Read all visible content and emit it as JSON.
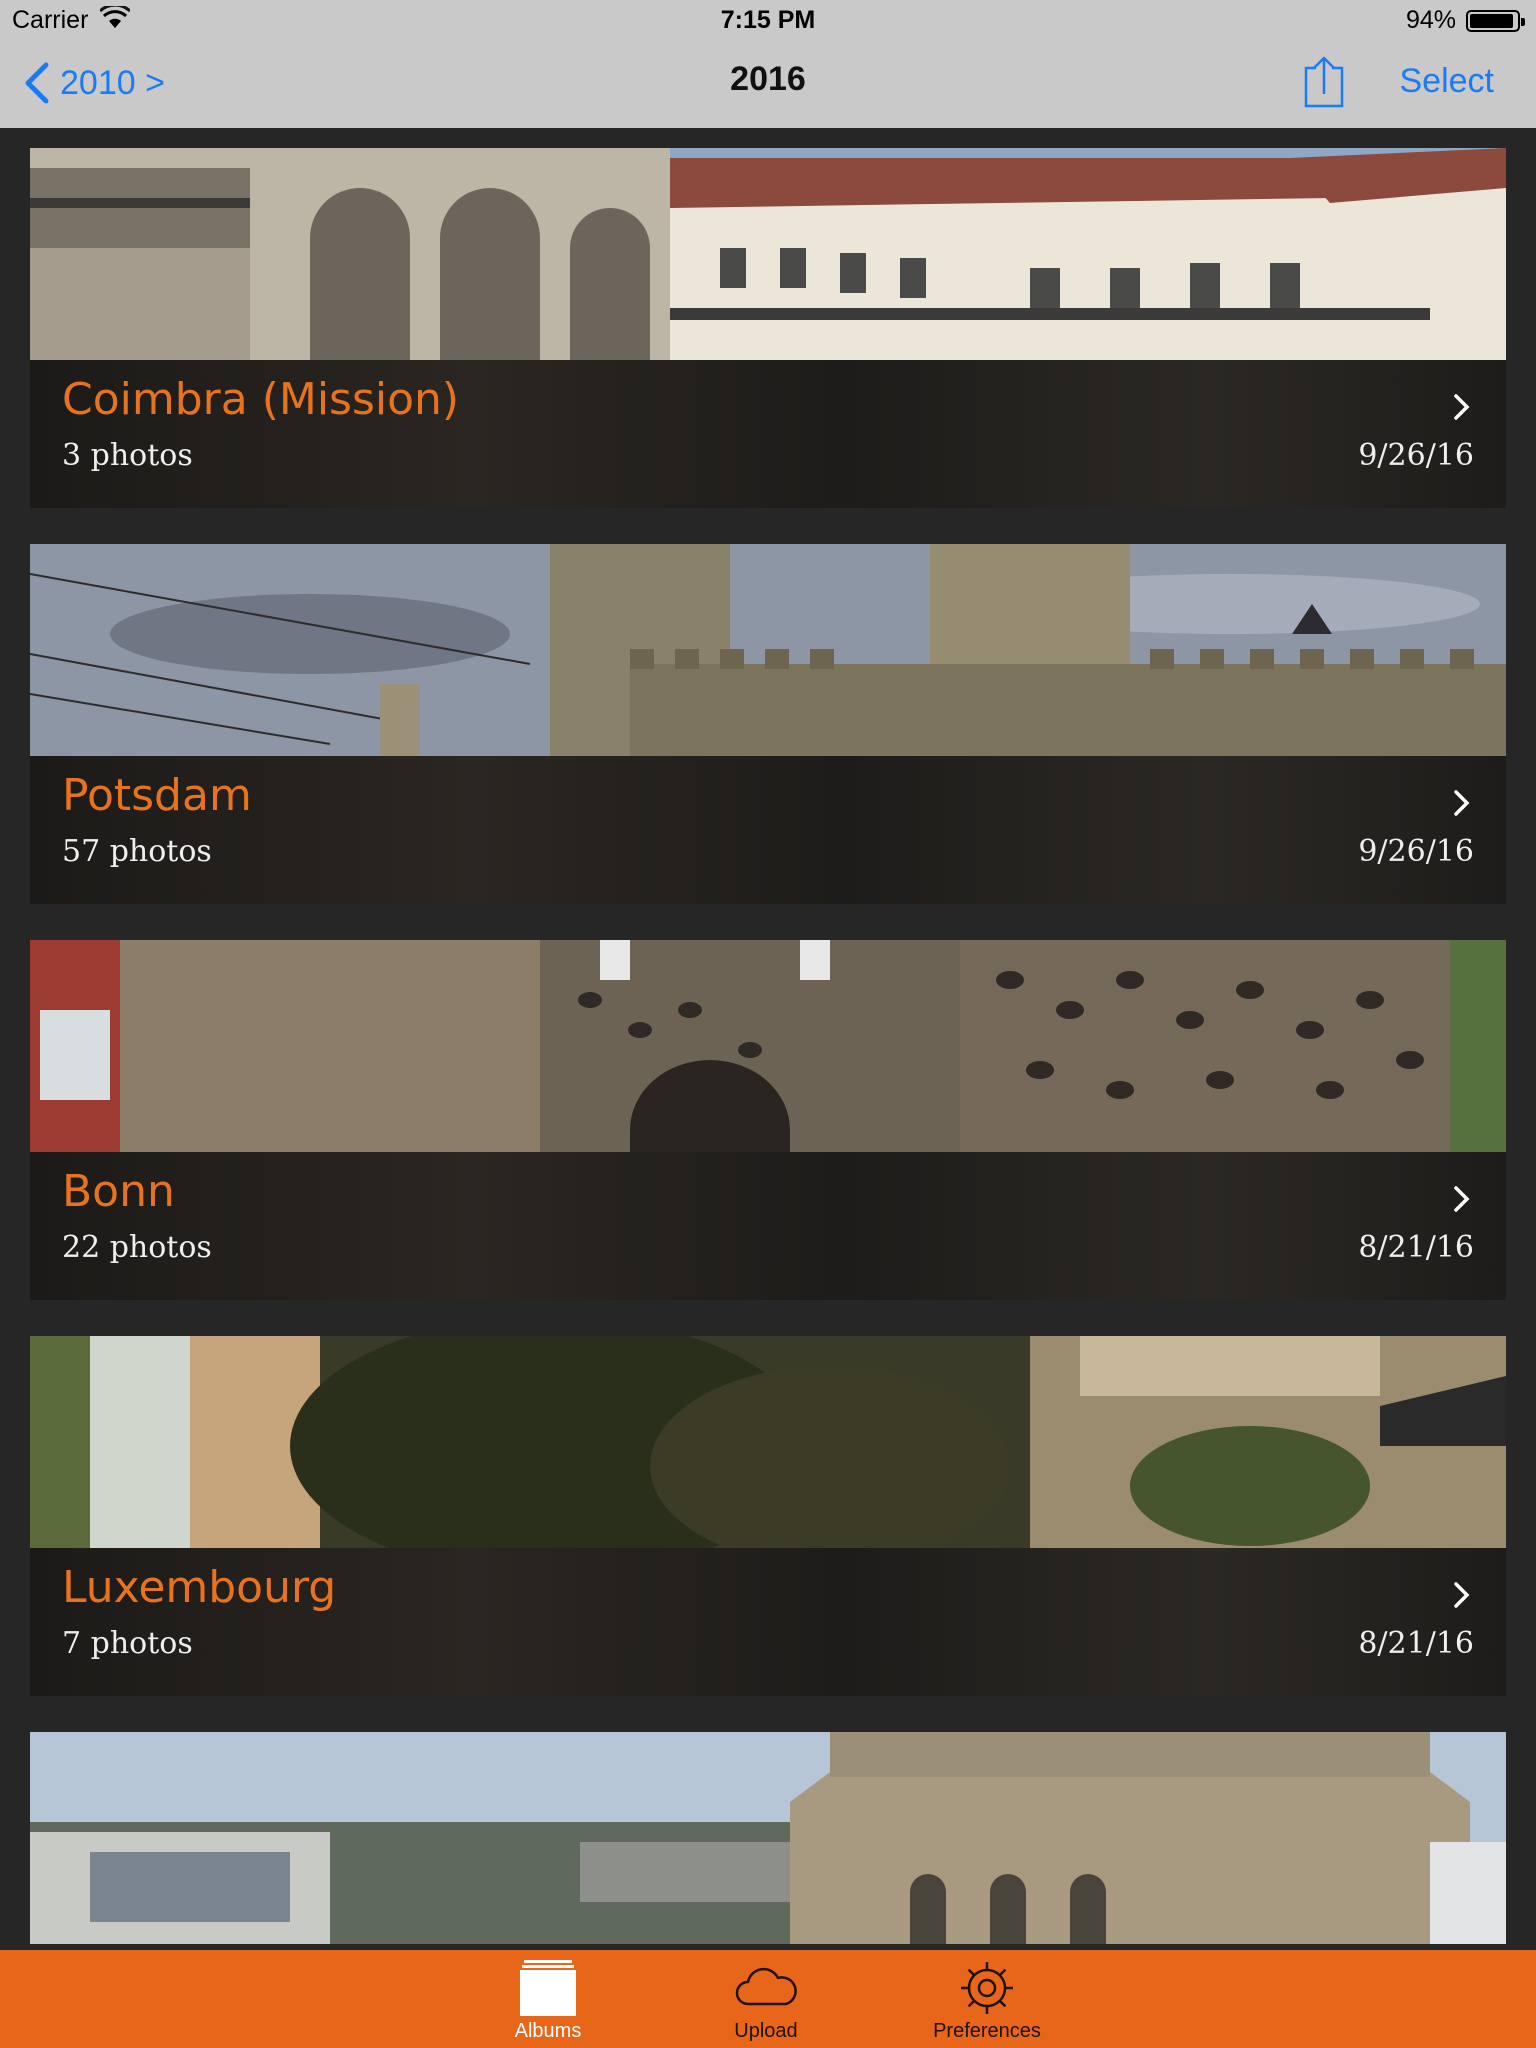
{
  "status_bar": {
    "carrier": "Carrier",
    "time": "7:15 PM",
    "battery_percent": "94%",
    "battery_level": 0.94
  },
  "nav_bar": {
    "back_label": "2010 >",
    "title": "2016",
    "share_icon": "share-icon",
    "select_label": "Select",
    "accent_color": "#1a7cf5"
  },
  "albums": [
    {
      "title": "Coimbra (Mission)",
      "count": "3 photos",
      "date": "9/26/16"
    },
    {
      "title": "Potsdam",
      "count": "57 photos",
      "date": "9/26/16"
    },
    {
      "title": "Bonn",
      "count": "22 photos",
      "date": "8/21/16"
    },
    {
      "title": "Luxembourg",
      "count": "7 photos",
      "date": "8/21/16"
    }
  ],
  "theme": {
    "album_title_color": "#e8731f",
    "tab_bar_color": "#e8661a",
    "background": "#262626"
  },
  "tab_bar": {
    "tabs": [
      {
        "label": "Albums",
        "icon": "albums-icon",
        "active": true
      },
      {
        "label": "Upload",
        "icon": "cloud-icon",
        "active": false
      },
      {
        "label": "Preferences",
        "icon": "gear-icon",
        "active": false
      }
    ]
  }
}
